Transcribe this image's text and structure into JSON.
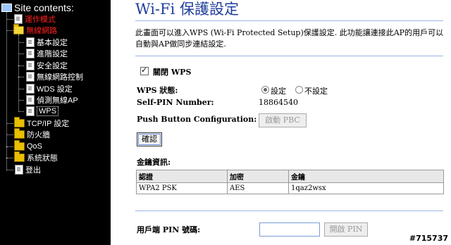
{
  "sidebar": {
    "title": "Site contents:",
    "items": {
      "mode": "運作模式",
      "wireless": "無線網路",
      "basic": "基本設定",
      "advanced": "進階設定",
      "security": "安全設定",
      "access_control": "無線網路控制",
      "wds": "WDS 設定",
      "site_survey": "偵測無線AP",
      "wps": "WPS",
      "tcpip": "TCP/IP 設定",
      "firewall": "防火牆",
      "qos": "QoS",
      "status": "系統狀態",
      "logout": "登出"
    }
  },
  "main": {
    "title": "Wi-Fi 保護設定",
    "description": "此畫面可以進入WPS (Wi-Fi Protected Setup)保護設定. 此功能讓連接此AP的用戶可以自動與AP做同步連結設定.",
    "disable_wps_label": "關閉 WPS",
    "wps_status_label": "WPS 狀態:",
    "status_configured": "設定",
    "status_unconfigured": "不設定",
    "self_pin_label": "Self-PIN Number:",
    "self_pin_value": "18864540",
    "pbc_label": "Push Button Configuration:",
    "pbc_button": "啟動 PBC",
    "apply_button": "確認",
    "key_info_label": "金鑰資訊:",
    "table": {
      "headers": [
        "認證",
        "加密",
        "金鑰"
      ],
      "row": [
        "WPA2 PSK",
        "AES",
        "1qaz2wsx"
      ]
    },
    "client_pin_label": "用戶端 PIN 號碼:",
    "client_pin_value": "",
    "start_pin_button": "開啟 PIN"
  },
  "watermark": "#715737",
  "colors": {
    "title": "#1f3f9a",
    "sidebar_bg": "#000000",
    "active_item": "#ff2020"
  }
}
